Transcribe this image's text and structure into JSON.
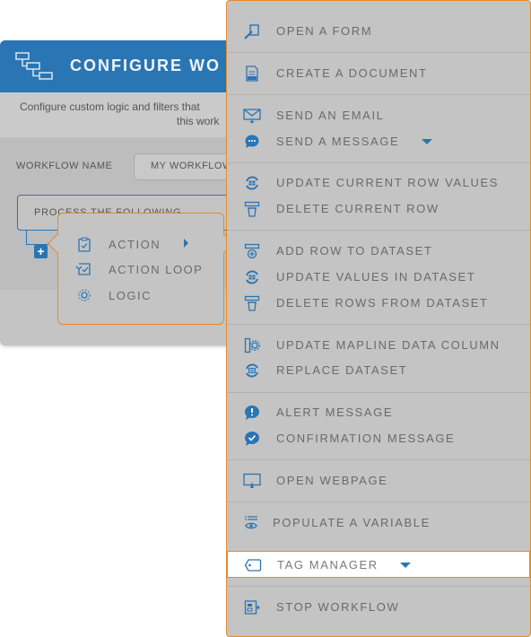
{
  "dialog": {
    "title": "CONFIGURE WO",
    "description_line1": "Configure custom logic and filters that",
    "description_line2": "this work",
    "workflow_name_label": "WORKFLOW NAME",
    "workflow_name_value": "MY WORKFLOW",
    "process_text": "PROCESS THE FOLLOWING",
    "add_symbol": "+"
  },
  "popup": {
    "items": [
      {
        "label": "ACTION",
        "icon": "clipboard-check-icon",
        "has_submenu": true
      },
      {
        "label": "ACTION LOOP",
        "icon": "loop-check-icon"
      },
      {
        "label": "LOGIC",
        "icon": "gear-logic-icon"
      }
    ]
  },
  "actions": {
    "open_form": "OPEN A FORM",
    "create_document": "CREATE A DOCUMENT",
    "send_email": "SEND AN EMAIL",
    "send_message": "SEND A MESSAGE",
    "update_current_row": "UPDATE CURRENT ROW VALUES",
    "delete_current_row": "DELETE CURRENT ROW",
    "add_row": "ADD ROW TO DATASET",
    "update_values": "UPDATE VALUES IN DATASET",
    "delete_rows": "DELETE ROWS FROM DATASET",
    "update_data_column": "UPDATE MAPLINE DATA COLUMN",
    "replace_dataset": "REPLACE DATASET",
    "alert_message": "ALERT MESSAGE",
    "confirmation_message": "CONFIRMATION MESSAGE",
    "open_webpage": "OPEN WEBPAGE",
    "populate_variable": "POPULATE A VARIABLE",
    "tag_manager": "TAG MANAGER",
    "stop_workflow": "STOP WORKFLOW"
  },
  "colors": {
    "accent_blue": "#2a75b3",
    "highlight_orange": "#e58a2b",
    "menu_text": "#6a6a6a",
    "background_gray": "#c4c4c4"
  }
}
